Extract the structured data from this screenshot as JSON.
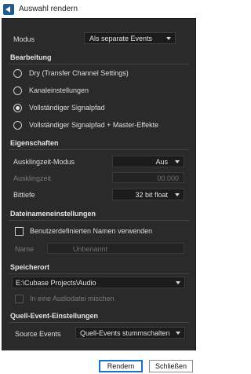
{
  "window": {
    "title": "Auswahl rendern"
  },
  "modus": {
    "label": "Modus",
    "value": "Als separate Events"
  },
  "bearbeitung": {
    "title": "Bearbeitung",
    "options": [
      "Dry (Transfer Channel Settings)",
      "Kanaleinstellungen",
      "Vollständiger Signalpfad",
      "Vollständiger Signalpfad + Master-Effekte"
    ],
    "selected_index": 2
  },
  "eigenschaften": {
    "title": "Eigenschaften",
    "ausklingzeit_modus_label": "Ausklingzeit-Modus",
    "ausklingzeit_modus_value": "Aus",
    "ausklingzeit_label": "Ausklingzeit",
    "ausklingzeit_value": "00.000",
    "bittiefe_label": "Bittiefe",
    "bittiefe_value": "32 bit float"
  },
  "dateinamen": {
    "title": "Dateinameneinstellungen",
    "checkbox_label": "Benutzerdefinierten Namen verwenden",
    "checked": false,
    "name_label": "Name",
    "name_placeholder": "Unbenannt"
  },
  "speicherort": {
    "title": "Speicherort",
    "path": "E:\\Cubase Projects\\Audio",
    "mix_label": "In eine Audiodatei mischen",
    "mix_checked": false
  },
  "quell_event": {
    "title": "Quell-Event-Einstellungen",
    "source_label": "Source Events",
    "source_value": "Quell-Events stummschalten"
  },
  "buttons": {
    "render": "Rendern",
    "close": "Schließen"
  }
}
